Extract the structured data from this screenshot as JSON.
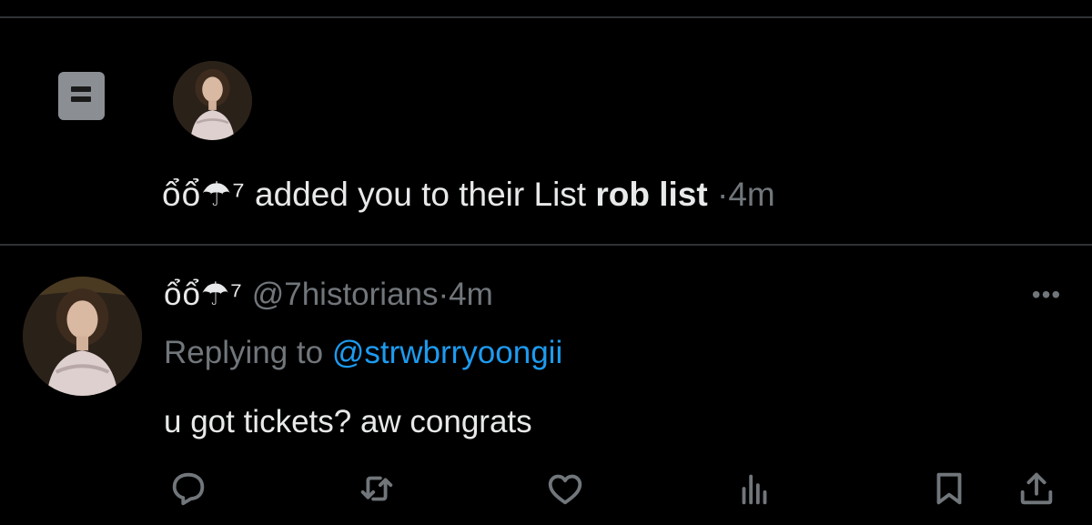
{
  "notification": {
    "display_name": "ổổ☂⁷",
    "action_text": "added you to their List",
    "list_name": "rob list",
    "separator": "·",
    "time": "4m"
  },
  "tweet": {
    "display_name": "ổổ☂⁷",
    "handle": "@7historians",
    "separator": "·",
    "time": "4m",
    "more": "•••",
    "replying_prefix": "Replying to",
    "replying_handle": "@strwbrryoongii",
    "body": "u got tickets? aw congrats"
  },
  "actions": [
    {
      "name": "reply",
      "icon": "reply-icon"
    },
    {
      "name": "retweet",
      "icon": "retweet-icon"
    },
    {
      "name": "like",
      "icon": "heart-icon"
    },
    {
      "name": "views",
      "icon": "views-icon"
    },
    {
      "name": "bookmark",
      "icon": "bookmark-icon"
    },
    {
      "name": "share",
      "icon": "share-icon"
    }
  ],
  "colors": {
    "background": "#000000",
    "text": "#e7e9ea",
    "muted": "#71767b",
    "link": "#1d9bf0",
    "divider": "#2f3336"
  }
}
